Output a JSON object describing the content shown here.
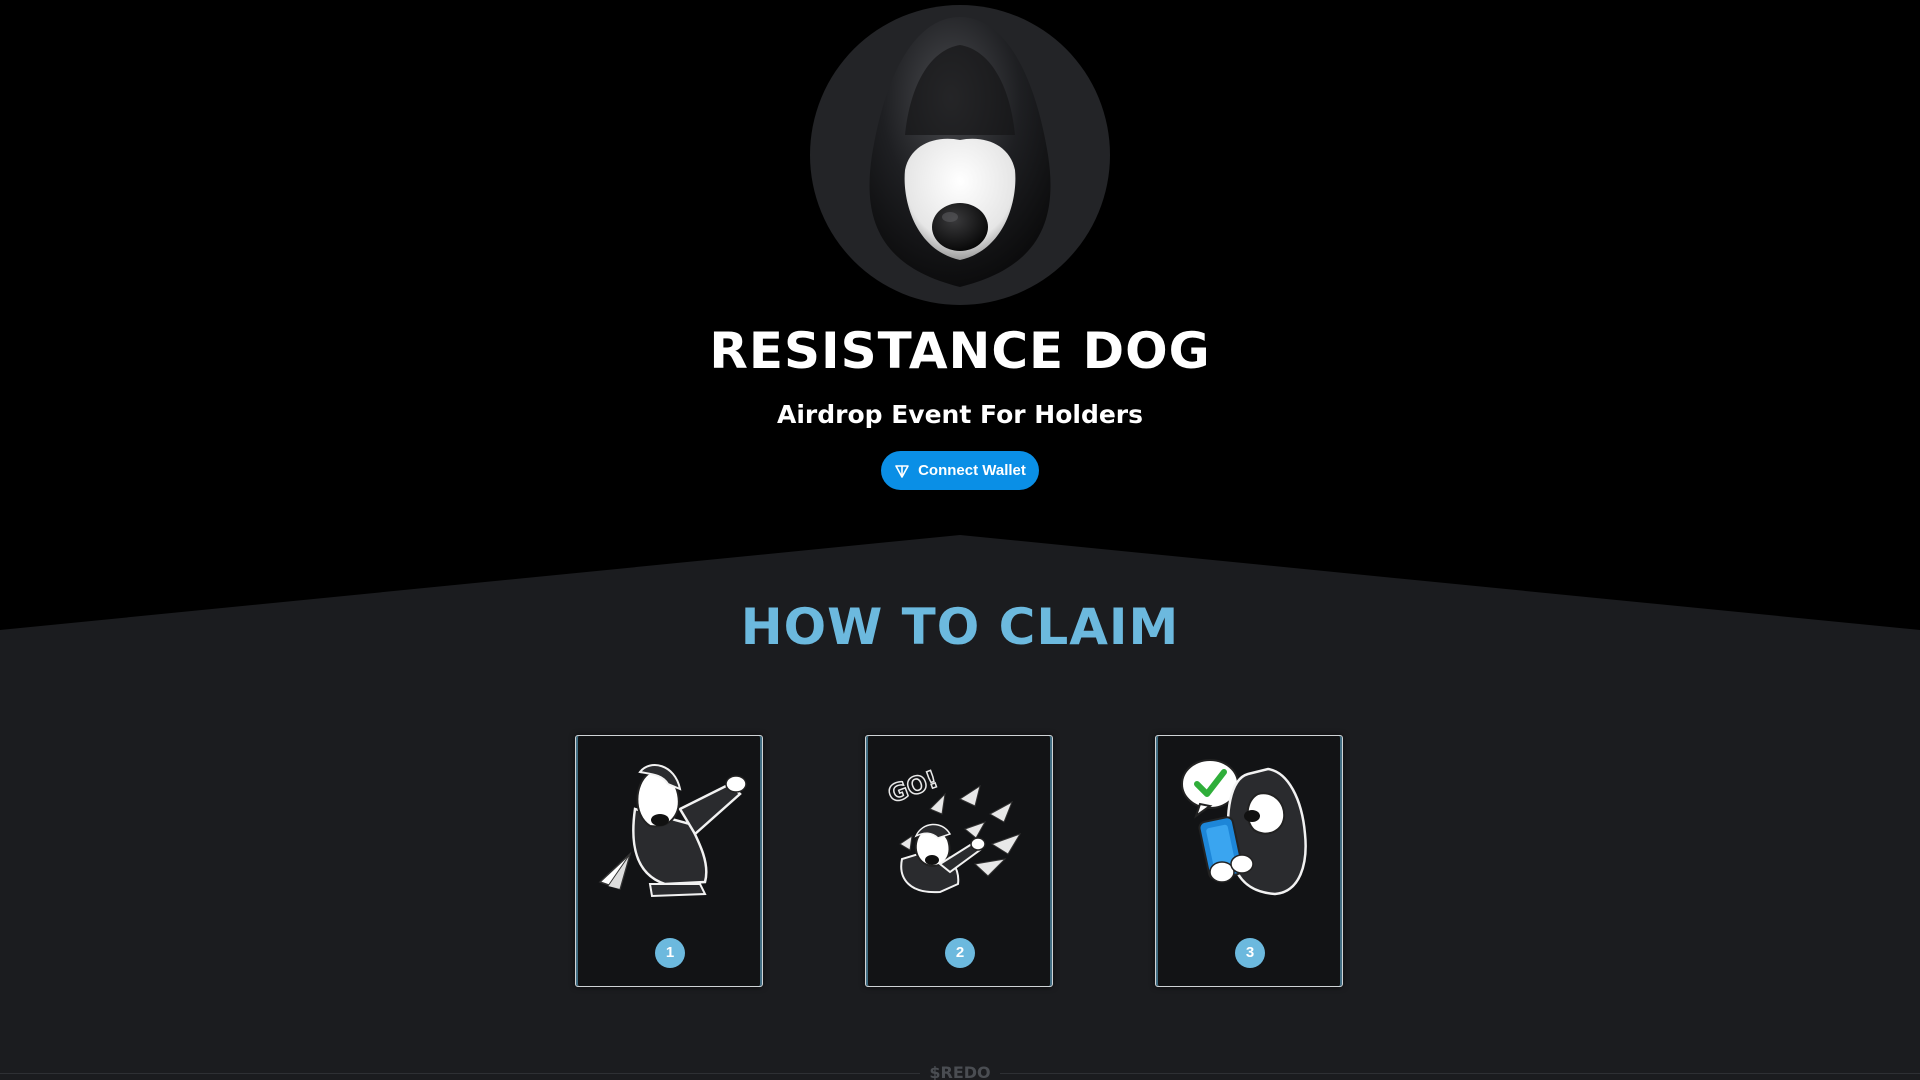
{
  "hero": {
    "title": "RESISTANCE DOG",
    "subtitle": "Airdrop Event For Holders",
    "connect_button": {
      "label": "Connect Wallet",
      "icon": "ton-diamond-icon",
      "color": "#0a8fe6"
    }
  },
  "how_to_claim": {
    "heading": "HOW TO CLAIM",
    "accent_color": "#6cb9de",
    "steps": [
      {
        "number": "1",
        "illustration": "dog-throwing-paper-plane"
      },
      {
        "number": "2",
        "illustration": "dog-launching-paper-planes-go"
      },
      {
        "number": "3",
        "illustration": "dog-with-phone-checkmark"
      }
    ]
  },
  "footer": {
    "label": "$REDO"
  },
  "colors": {
    "hero_background": "#000000",
    "section_background": "#1b1c1f"
  }
}
